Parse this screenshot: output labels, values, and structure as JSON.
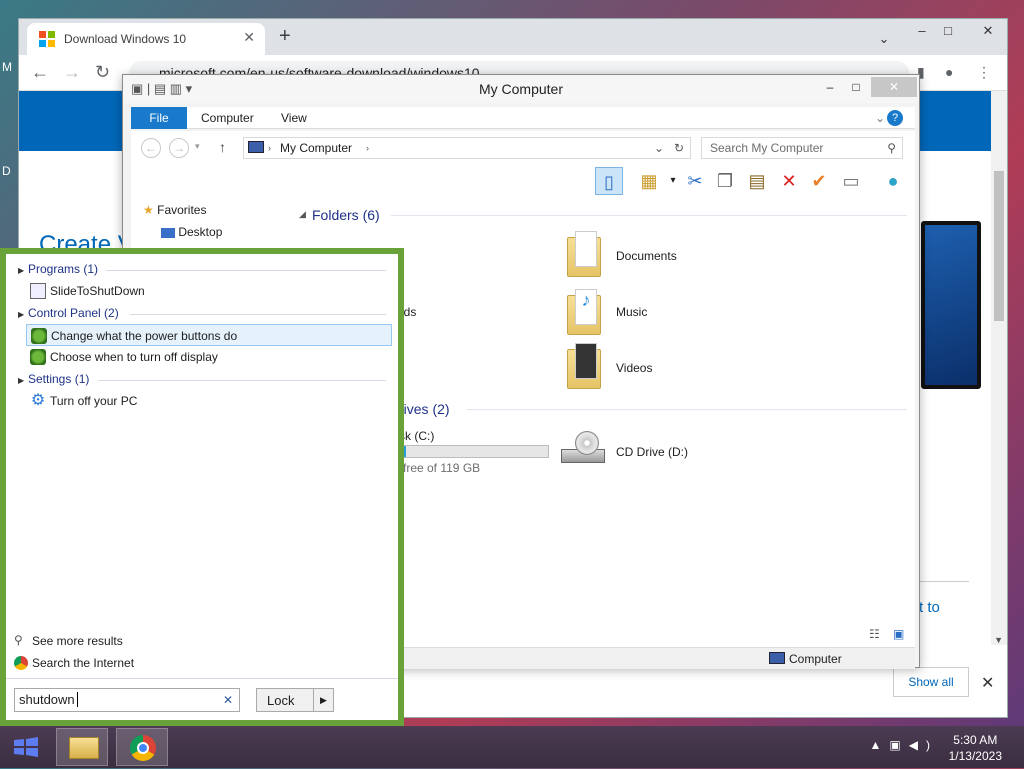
{
  "browser": {
    "tab_title": "Download Windows 10",
    "url": "microsoft.com/en-us/software-download/windows10",
    "page_heading": "Create V",
    "side_link": "t to",
    "show_all": "Show all"
  },
  "explorer": {
    "title": "My Computer",
    "ribbon_tabs": [
      "File",
      "Computer",
      "View"
    ],
    "address": "My Computer",
    "search_placeholder": "Search My Computer",
    "nav": {
      "favorites": "Favorites",
      "desktop": "Desktop"
    },
    "folders_header": "Folders (6)",
    "folders": [
      "Documents",
      "Music",
      "Videos"
    ],
    "partial_downloads": "ads",
    "drives_header_partial": "rives (2)",
    "disk_label_partial": "sk (C:)",
    "disk_free_partial": "free of 119 GB",
    "disk_fill_fraction": 0.04,
    "cd_drive": "CD Drive (D:)",
    "status_computer": "Computer"
  },
  "start_search": {
    "groups": {
      "programs": "Programs (1)",
      "control_panel": "Control Panel (2)",
      "settings": "Settings (1)"
    },
    "results": {
      "slide": "SlideToShutDown",
      "power_buttons": "Change what the power buttons do",
      "turn_off_display": "Choose when to turn off display",
      "turn_off_pc": "Turn off your PC"
    },
    "see_more": "See more results",
    "search_internet": "Search the Internet",
    "query": "shutdown",
    "lock_label": "Lock"
  },
  "taskbar": {
    "time": "5:30 AM",
    "date": "1/13/2023"
  },
  "colors": {
    "accent_blue": "#1979ca",
    "start_panel_green": "#6aa23a",
    "ms_blue": "#0067b8"
  }
}
